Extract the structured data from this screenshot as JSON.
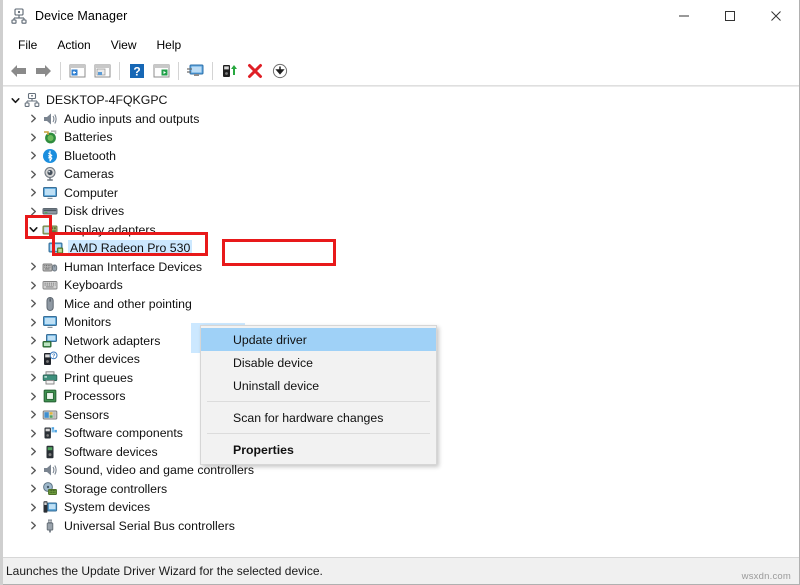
{
  "window": {
    "title": "Device Manager",
    "icon": "device-manager-icon",
    "controls": [
      {
        "name": "minimize-button",
        "glyph": "minimize-icon"
      },
      {
        "name": "maximize-button",
        "glyph": "maximize-icon"
      },
      {
        "name": "close-button",
        "glyph": "close-icon"
      }
    ]
  },
  "menubar": {
    "items": [
      {
        "label": "File"
      },
      {
        "label": "Action"
      },
      {
        "label": "View"
      },
      {
        "label": "Help"
      }
    ]
  },
  "toolbar": {
    "buttons": [
      {
        "name": "back-button",
        "icon": "back-arrow-icon"
      },
      {
        "name": "forward-button",
        "icon": "forward-arrow-icon"
      },
      {
        "name": "separator-1",
        "icon": "separator"
      },
      {
        "name": "show-hide-console-tree-button",
        "icon": "console-tree-icon"
      },
      {
        "name": "properties-button",
        "icon": "properties-window-icon"
      },
      {
        "name": "separator-2",
        "icon": "separator"
      },
      {
        "name": "help-button",
        "icon": "question-mark-icon"
      },
      {
        "name": "show-hide-action-pane-button",
        "icon": "action-pane-icon"
      },
      {
        "name": "separator-3",
        "icon": "separator"
      },
      {
        "name": "scan-for-hardware-changes-button",
        "icon": "monitor-scan-icon"
      },
      {
        "name": "separator-4",
        "icon": "separator"
      },
      {
        "name": "update-driver-button",
        "icon": "update-driver-icon"
      },
      {
        "name": "uninstall-device-button",
        "icon": "red-x-icon"
      },
      {
        "name": "disable-device-button",
        "icon": "down-arrow-circle-icon"
      }
    ]
  },
  "tree": {
    "root": {
      "label": "DESKTOP-4FQKGPC",
      "icon": "computer-node-icon",
      "expanded": true
    },
    "items": [
      {
        "label": "Audio inputs and outputs",
        "icon": "speaker-icon",
        "level": 1,
        "expandable": true
      },
      {
        "label": "Batteries",
        "icon": "battery-icon",
        "level": 1,
        "expandable": true
      },
      {
        "label": "Bluetooth",
        "icon": "bluetooth-icon",
        "level": 1,
        "expandable": true
      },
      {
        "label": "Cameras",
        "icon": "camera-icon",
        "level": 1,
        "expandable": true
      },
      {
        "label": "Computer",
        "icon": "monitor-icon",
        "level": 1,
        "expandable": true
      },
      {
        "label": "Disk drives",
        "icon": "disk-drive-icon",
        "level": 1,
        "expandable": true
      },
      {
        "label": "Display adapters",
        "icon": "display-adapter-icon",
        "level": 1,
        "expandable": true,
        "expanded": true
      },
      {
        "label": "AMD Radeon Pro 530",
        "icon": "display-adapter-icon",
        "level": 2,
        "expandable": false,
        "selected": true
      },
      {
        "label": "Human Interface Devices",
        "icon": "hid-icon",
        "level": 1,
        "expandable": true
      },
      {
        "label": "Keyboards",
        "icon": "keyboard-icon",
        "level": 1,
        "expandable": true
      },
      {
        "label": "Mice and other pointing",
        "icon": "mouse-icon",
        "level": 1,
        "expandable": true
      },
      {
        "label": "Monitors",
        "icon": "monitor-icon",
        "level": 1,
        "expandable": true
      },
      {
        "label": "Network adapters",
        "icon": "network-adapter-icon",
        "level": 1,
        "expandable": true
      },
      {
        "label": "Other devices",
        "icon": "unknown-device-icon",
        "level": 1,
        "expandable": true
      },
      {
        "label": "Print queues",
        "icon": "printer-icon",
        "level": 1,
        "expandable": true
      },
      {
        "label": "Processors",
        "icon": "processor-icon",
        "level": 1,
        "expandable": true
      },
      {
        "label": "Sensors",
        "icon": "sensor-icon",
        "level": 1,
        "expandable": true
      },
      {
        "label": "Software components",
        "icon": "software-component-icon",
        "level": 1,
        "expandable": true
      },
      {
        "label": "Software devices",
        "icon": "software-device-icon",
        "level": 1,
        "expandable": true
      },
      {
        "label": "Sound, video and game controllers",
        "icon": "speaker-icon",
        "level": 1,
        "expandable": true
      },
      {
        "label": "Storage controllers",
        "icon": "storage-controller-icon",
        "level": 1,
        "expandable": true
      },
      {
        "label": "System devices",
        "icon": "system-device-icon",
        "level": 1,
        "expandable": true
      },
      {
        "label": "Universal Serial Bus controllers",
        "icon": "usb-icon",
        "level": 1,
        "expandable": true
      }
    ]
  },
  "context_menu": {
    "items": [
      {
        "label": "Update driver",
        "highlighted": true,
        "bold": false
      },
      {
        "label": "Disable device",
        "highlighted": false,
        "bold": false
      },
      {
        "label": "Uninstall device",
        "highlighted": false,
        "bold": false
      },
      {
        "separator": true
      },
      {
        "label": "Scan for hardware changes",
        "highlighted": false,
        "bold": false
      },
      {
        "separator": true
      },
      {
        "label": "Properties",
        "highlighted": false,
        "bold": true
      }
    ]
  },
  "statusbar": {
    "text": "Launches the Update Driver Wizard for the selected device.",
    "watermark": "wsxdn.com"
  },
  "annotations": {
    "highlight_color": "#e8191a",
    "boxes": [
      {
        "name": "display-adapters-expand-chevron-highlight"
      },
      {
        "name": "amd-radeon-device-highlight"
      },
      {
        "name": "update-driver-menu-item-highlight"
      }
    ]
  },
  "colors": {
    "selection_blue": "#cce8ff",
    "menu_highlight_blue": "#9fd1f7",
    "annotation_red": "#e8191a",
    "statusbar_bg": "#f0f0f0"
  }
}
